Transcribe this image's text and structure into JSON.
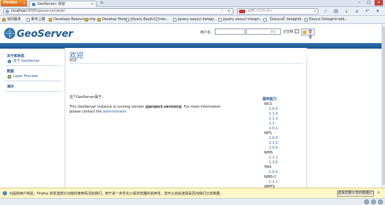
{
  "browser": {
    "menu_label": "Firefox",
    "tab_title": "GeoServer: 欢迎",
    "url_host": "localhost",
    "url_rest": ":8080/geoserver/web/",
    "search_placeholder": "百度 <Ctrl+K>",
    "bookmarks": [
      {
        "label": "访问最多",
        "icon": "folder"
      },
      {
        "label": "新手上路",
        "icon": "page"
      },
      {
        "label": "Develope Resources",
        "icon": "folder"
      },
      {
        "label": "trip",
        "icon": "folder"
      },
      {
        "label": "Develop Tools",
        "icon": "folder"
      },
      {
        "label": "JQuery EasyUI之tree...",
        "icon": "page"
      },
      {
        "label": "jquery easyui datagr...",
        "icon": "page"
      },
      {
        "label": "jquery easyui treegri...",
        "icon": "page"
      },
      {
        "label": "【easyui】datagrid...",
        "icon": "page"
      },
      {
        "label": "Easyui Datagrid edit...",
        "icon": "page"
      }
    ]
  },
  "header": {
    "logo_text": "GeoServer",
    "username_label": "用户名",
    "password_label": "密码",
    "remember_label": "记住我",
    "login_label": "登录"
  },
  "sidebar": {
    "sections": [
      {
        "title": "关于和状态",
        "items": [
          {
            "label": "关于 GeoServer",
            "icon": "info-icon"
          }
        ]
      },
      {
        "title": "数据",
        "items": [
          {
            "label": "Layer Preview",
            "icon": "map-icon"
          }
        ]
      },
      {
        "title": "演示",
        "items": []
      }
    ]
  },
  "main": {
    "title": "欢迎",
    "subtitle": "欢迎",
    "welcome_text": "这个GeoServer属于 .",
    "running_prefix": "This GeoServer instance is running version ",
    "version": "@project.version@",
    "running_suffix": ". For more information",
    "contact_prefix": "please contact the ",
    "contact_link": "administrator",
    "contact_suffix": "."
  },
  "capabilities": {
    "title": "服务能力",
    "services": [
      {
        "name": "WCS",
        "versions": [
          "1.0.0",
          "1.1.0",
          "1.1.1",
          "1.1",
          "2.0.1"
        ]
      },
      {
        "name": "WFS",
        "versions": [
          "1.0.0",
          "1.1.0",
          "2.0.0"
        ]
      },
      {
        "name": "WMS",
        "versions": [
          "1.1.1",
          "1.3.0"
        ]
      },
      {
        "name": "TMS",
        "versions": [
          "1.0.0"
        ]
      },
      {
        "name": "WMS-C",
        "versions": [
          "1.1.1"
        ]
      },
      {
        "name": "WMTS",
        "versions": [
          "1.0.0"
        ]
      }
    ]
  },
  "notification": {
    "message": "为提高用户体验，Firefox 将发送部分功能的使用情况给我们，用于进一步优化火狐浏览器的易用性，您可以自由选择是否向我们分享数据。",
    "button_label": "选择您要分享的数据(C)"
  }
}
